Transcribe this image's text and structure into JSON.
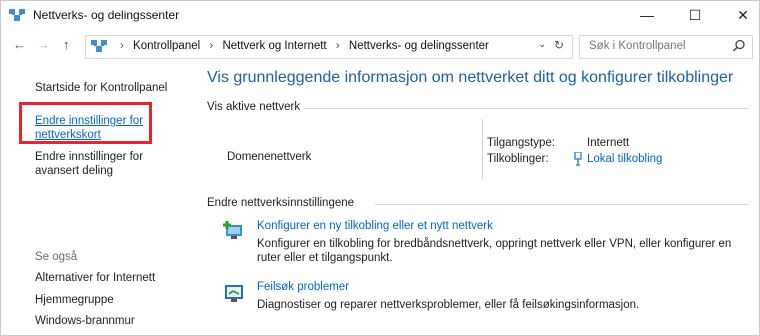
{
  "window": {
    "title": "Nettverks- og delingssenter",
    "controls": {
      "minimize": "—",
      "maximize": "☐",
      "close": "✕"
    }
  },
  "nav": {
    "back": "←",
    "forward": "→",
    "up": "↑",
    "breadcrumbs": [
      "Kontrollpanel",
      "Nettverk og Internett",
      "Nettverks- og delingssenter"
    ],
    "separator": "›",
    "dropdown": "⌄",
    "refresh": "↻",
    "search_placeholder": "Søk i Kontrollpanel"
  },
  "sidebar": {
    "home": "Startside for Kontrollpanel",
    "adapter_settings": "Endre innstillinger for nettverkskort",
    "advanced_sharing": "Endre innstillinger for avansert deling",
    "see_also_header": "Se også",
    "see_also": [
      "Alternativer for Internett",
      "Hjemmegruppe",
      "Windows-brannmur"
    ]
  },
  "main": {
    "title": "Vis grunnleggende informasjon om nettverket ditt og konfigurer tilkoblinger",
    "active_header": "Vis aktive nettverk",
    "network_name": "Domenenettverk",
    "access_type_label": "Tilgangstype:",
    "access_type_value": "Internett",
    "connections_label": "Tilkoblinger:",
    "connections_value": "Lokal tilkobling",
    "change_header": "Endre nettverksinnstillingene",
    "tasks": [
      {
        "link": "Konfigurer en ny tilkobling eller et nytt nettverk",
        "desc": "Konfigurer en tilkobling for bredbåndsnettverk, oppringt nettverk eller VPN, eller konfigurer en ruter eller et tilgangspunkt."
      },
      {
        "link": "Feilsøk problemer",
        "desc": "Diagnostiser og reparer nettverksproblemer, eller få feilsøkingsinformasjon."
      }
    ]
  },
  "colors": {
    "link": "#0066cc",
    "title": "#1d5fa8",
    "highlight": "#e8242c"
  }
}
